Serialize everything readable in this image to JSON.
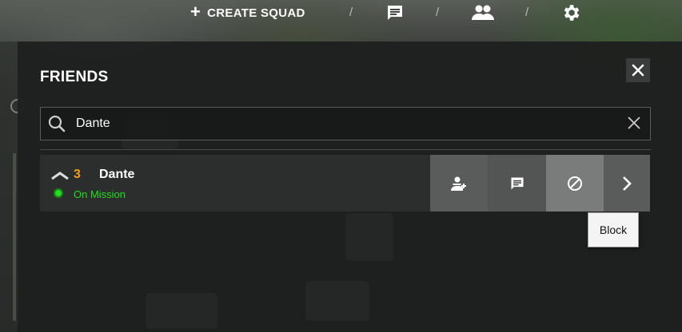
{
  "topbar": {
    "create_squad_label": "CREATE SQUAD",
    "separator": "/",
    "icons": [
      "chat-icon",
      "friends-icon",
      "settings-icon"
    ]
  },
  "friends_panel": {
    "title": "FRIENDS",
    "search": {
      "value": "Dante",
      "placeholder": ""
    },
    "friends": [
      {
        "level": "3",
        "name": "Dante",
        "status": "On Mission",
        "status_color": "#22dd22"
      }
    ],
    "tooltip": "Block"
  },
  "colors": {
    "level": "#f0a020",
    "online": "#22dd22",
    "panel_bg": "#1e1f1f"
  }
}
